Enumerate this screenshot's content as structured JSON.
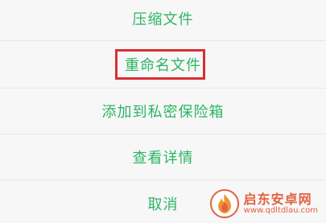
{
  "menu": {
    "items": [
      {
        "label": "压缩文件"
      },
      {
        "label": "重命名文件"
      },
      {
        "label": "添加到私密保险箱"
      },
      {
        "label": "查看详情"
      },
      {
        "label": "取消"
      }
    ]
  },
  "highlight": {
    "color": "#d82f34",
    "target": "重命名文件"
  },
  "colors": {
    "accent": "#2db565",
    "background": "#f7f7f7",
    "divider": "#e6e6e6"
  },
  "watermark": {
    "title": "启东安卓网",
    "url": "www.qdltdlau.com",
    "icon": "flame-logo-icon"
  }
}
